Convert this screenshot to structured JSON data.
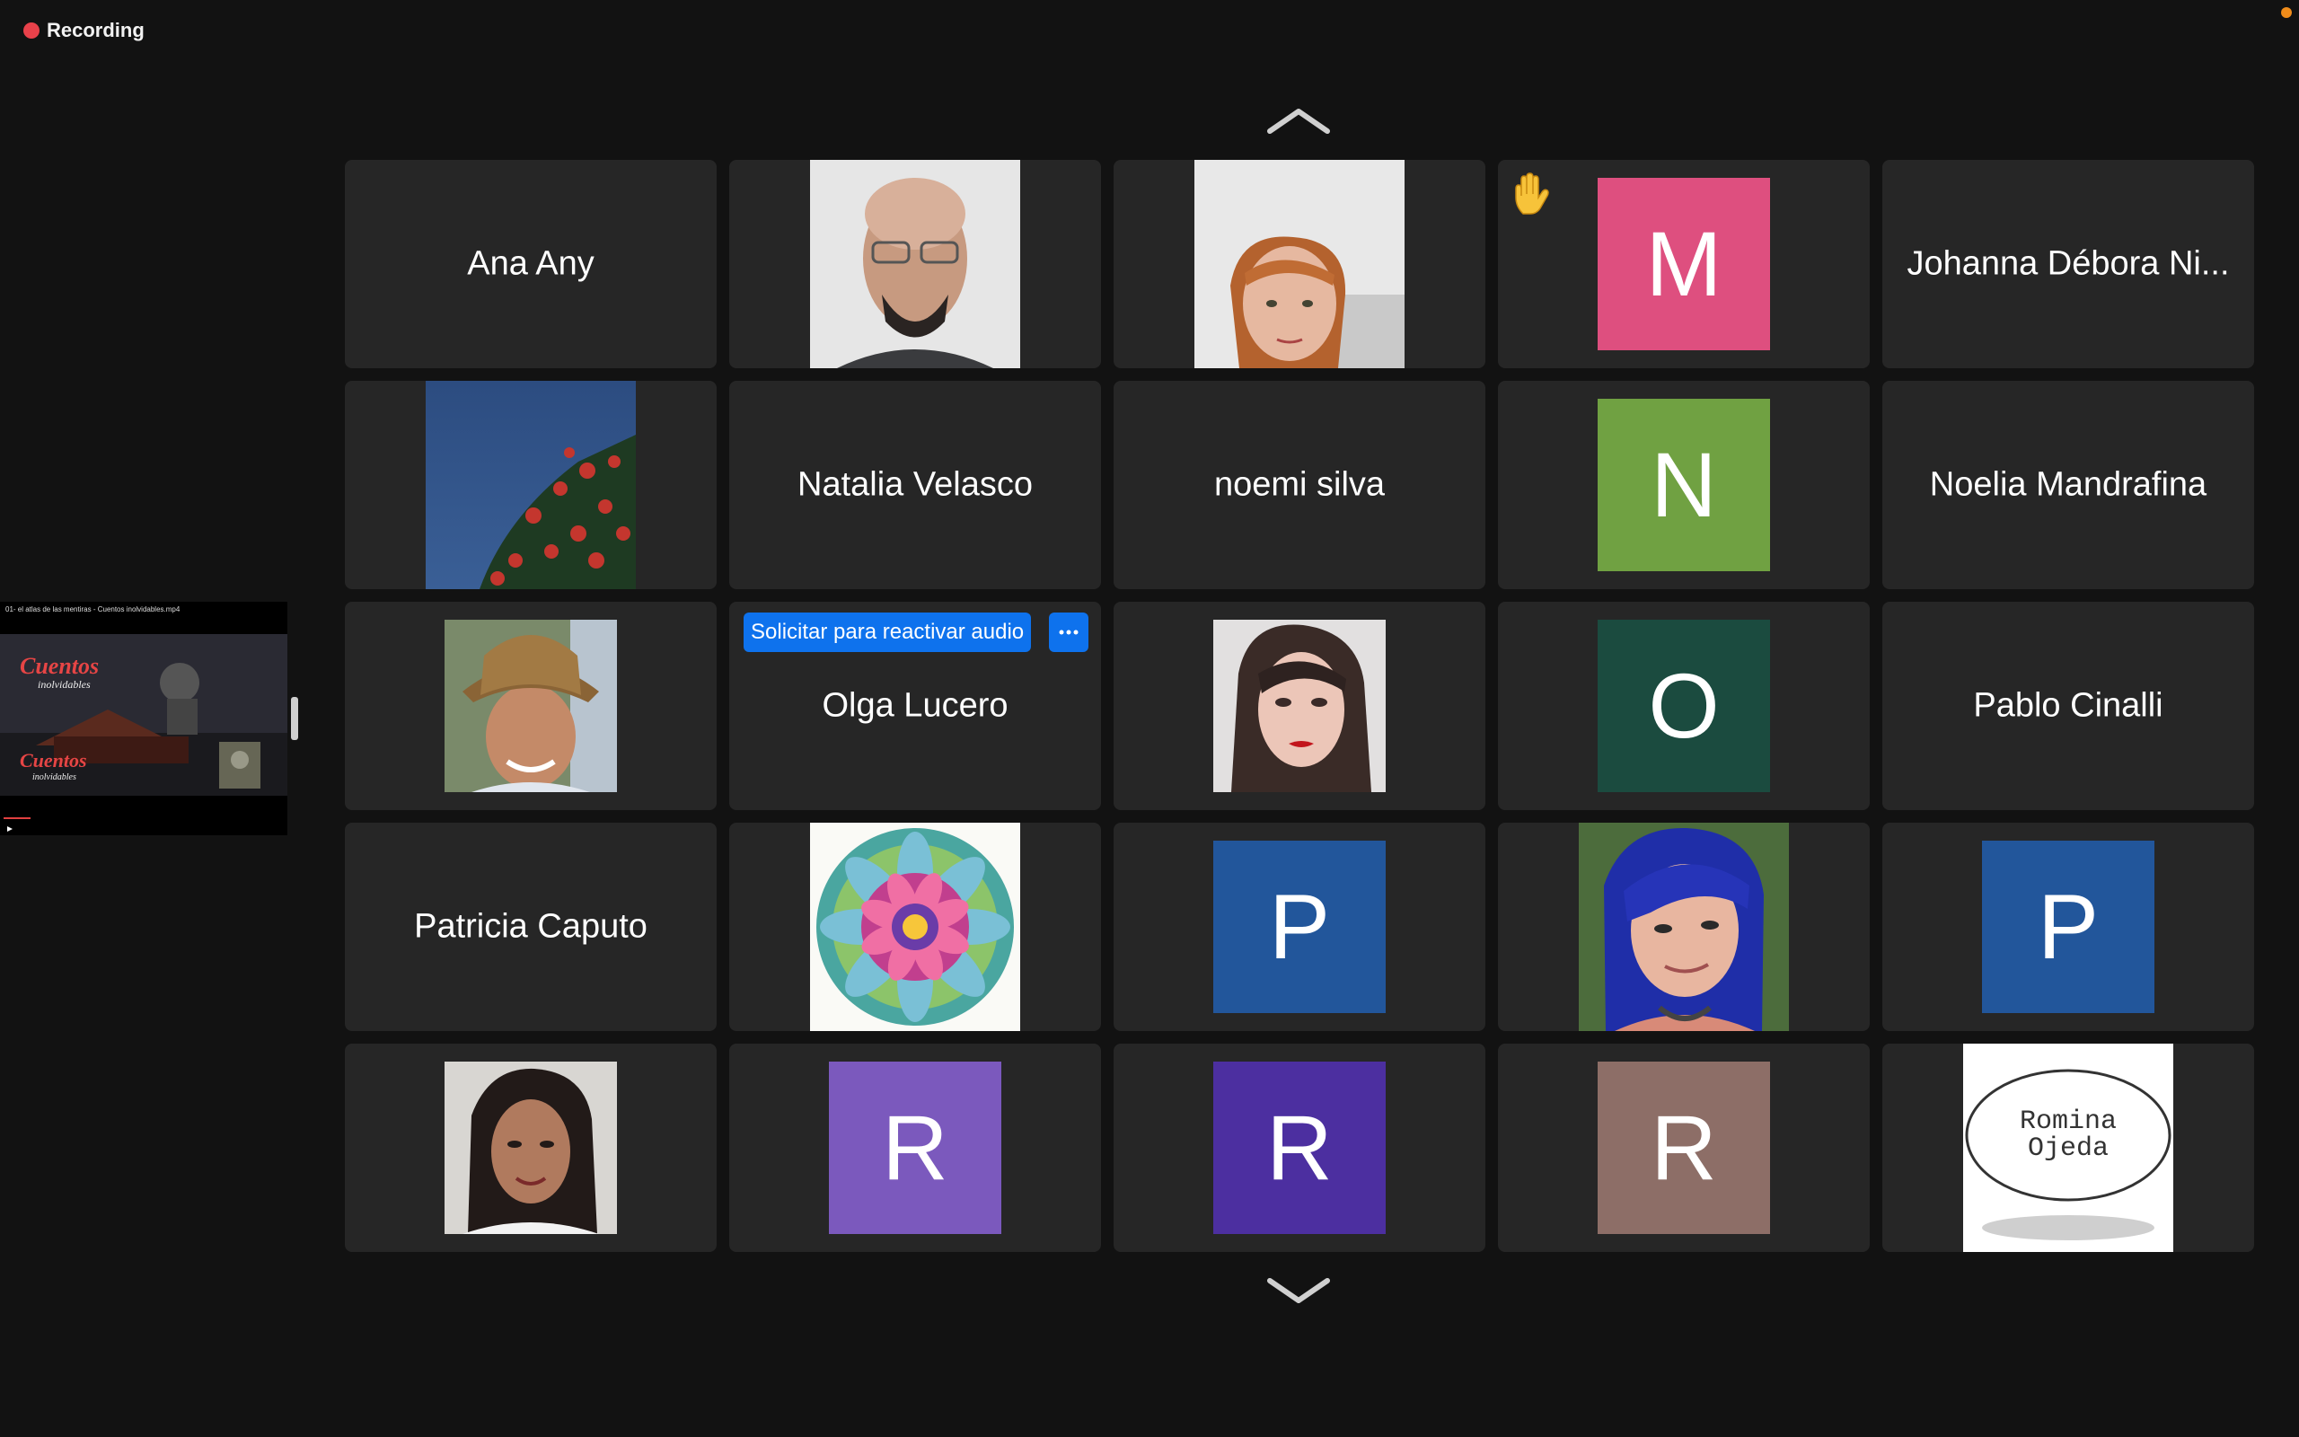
{
  "recording": {
    "label": "Recording"
  },
  "shared_video": {
    "title": "01- el atlas de las mentiras - Cuentos inolvidables.mp4"
  },
  "participants": [
    {
      "name": "Ana Any",
      "type": "name"
    },
    {
      "name": "",
      "type": "photo",
      "photo": "bald-man"
    },
    {
      "name": "",
      "type": "photo",
      "photo": "redhead-woman"
    },
    {
      "name": "",
      "type": "avatar",
      "initial": "M",
      "color": "#de4f7f",
      "raised_hand": true,
      "icon": "raised-hand-icon"
    },
    {
      "name": "Johanna Débora Ni...",
      "type": "name"
    },
    {
      "name": "",
      "type": "photo",
      "photo": "flowers-sky"
    },
    {
      "name": "Natalia Velasco",
      "type": "name"
    },
    {
      "name": "noemi silva",
      "type": "name"
    },
    {
      "name": "",
      "type": "avatar",
      "initial": "N",
      "color": "#70a142"
    },
    {
      "name": "Noelia Mandrafina",
      "type": "name"
    },
    {
      "name": "",
      "type": "photo",
      "photo": "hat-woman"
    },
    {
      "name": "Olga Lucero",
      "type": "name",
      "unmute_request_label": "Solicitar para reactivar audio",
      "more_label": "···"
    },
    {
      "name": "",
      "type": "photo",
      "photo": "dark-hair-woman"
    },
    {
      "name": "",
      "type": "avatar",
      "initial": "O",
      "color": "#1b4b3f"
    },
    {
      "name": "Pablo Cinalli",
      "type": "name"
    },
    {
      "name": "Patricia Caputo",
      "type": "name"
    },
    {
      "name": "",
      "type": "photo",
      "photo": "mandala"
    },
    {
      "name": "",
      "type": "avatar",
      "initial": "P",
      "color": "#22569b"
    },
    {
      "name": "",
      "type": "photo",
      "photo": "blue-hair-woman"
    },
    {
      "name": "",
      "type": "avatar",
      "initial": "P",
      "color": "#22569b"
    },
    {
      "name": "",
      "type": "photo",
      "photo": "curly-hair-woman"
    },
    {
      "name": "",
      "type": "avatar",
      "initial": "R",
      "color": "#7b59bd"
    },
    {
      "name": "",
      "type": "avatar",
      "initial": "R",
      "color": "#4c2fa0"
    },
    {
      "name": "",
      "type": "avatar",
      "initial": "R",
      "color": "#8d6e67"
    },
    {
      "name": "",
      "type": "photo",
      "photo": "romina-logo",
      "logo_text": [
        "Romina",
        "Ojeda"
      ]
    }
  ]
}
